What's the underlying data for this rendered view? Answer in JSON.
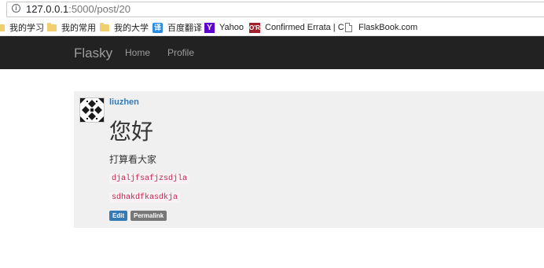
{
  "browser": {
    "url_host": "127.0.0.1",
    "url_path": ":5000/post/20",
    "info_glyph": "i"
  },
  "bookmarks": [
    {
      "label": "我的学习",
      "icon": "folder-icon"
    },
    {
      "label": "我的常用",
      "icon": "folder-icon"
    },
    {
      "label": "我的大学",
      "icon": "folder-icon"
    },
    {
      "label": "百度翻译",
      "icon": "fanyi-icon",
      "glyph": "译"
    },
    {
      "label": "Yahoo",
      "icon": "yahoo-icon",
      "glyph": "Y"
    },
    {
      "label": "Confirmed Errata | C",
      "icon": "oreilly-icon",
      "glyph": "O'R"
    },
    {
      "label": "FlaskBook.com",
      "icon": "page-icon"
    }
  ],
  "navbar": {
    "brand": "Flasky",
    "links": [
      "Home",
      "Profile"
    ],
    "bg_color": "#222222"
  },
  "post": {
    "author": "liuzhen",
    "title": "您好",
    "body": "打算看大家",
    "code_lines": [
      "djaljfsafjzsdjla",
      "sdhakdfkasdkja"
    ],
    "buttons": {
      "edit": "Edit",
      "permalink": "Permalink"
    },
    "accent_color": "#337ab7"
  }
}
